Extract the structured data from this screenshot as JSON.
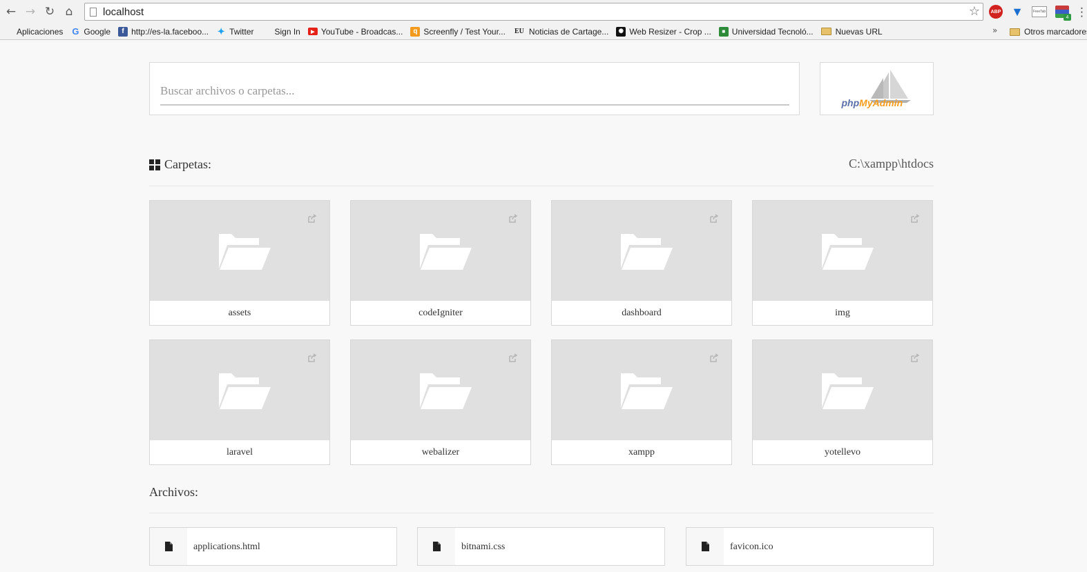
{
  "browser": {
    "url": "localhost",
    "extensions": {
      "abp_label": "ABP",
      "box_label": "FreeTab",
      "badge_count": "4"
    },
    "bookmarks": [
      {
        "label": "Aplicaciones",
        "icon": "apps-grid-icon",
        "color": "#e0453a"
      },
      {
        "label": "Google",
        "icon": "google-icon",
        "color": "#4285f4"
      },
      {
        "label": "http://es-la.faceboo...",
        "icon": "facebook-icon",
        "color": "#3b5998"
      },
      {
        "label": "Twitter",
        "icon": "twitter-icon",
        "color": "#1da1f2"
      },
      {
        "label": "Sign In",
        "icon": "microsoft-icon",
        "color": "#f25022"
      },
      {
        "label": "YouTube - Broadcas...",
        "icon": "youtube-icon",
        "color": "#e62117"
      },
      {
        "label": "Screenfly / Test Your...",
        "icon": "screenfly-icon",
        "color": "#f39a1c"
      },
      {
        "label": "Noticias de Cartage...",
        "icon": "eu-news-icon",
        "color": "#222222"
      },
      {
        "label": "Web Resizer - Crop ...",
        "icon": "web-resizer-icon",
        "color": "#111111"
      },
      {
        "label": "Universidad Tecnoló...",
        "icon": "university-icon",
        "color": "#2e8b3a"
      },
      {
        "label": "Nuevas URL",
        "icon": "folder-icon",
        "color": "#e8c26a"
      }
    ],
    "other_bookmarks": "Otros marcadores"
  },
  "search": {
    "placeholder": "Buscar archivos o carpetas..."
  },
  "phpmyadmin": {
    "php": "php",
    "admin": "MyAdmin"
  },
  "folders_section": {
    "title": "Carpetas:",
    "path": "C:\\xampp\\htdocs",
    "items": [
      "assets",
      "codeIgniter",
      "dashboard",
      "img",
      "laravel",
      "webalizer",
      "xampp",
      "yotellevo"
    ]
  },
  "files_section": {
    "title": "Archivos:",
    "items": [
      "applications.html",
      "bitnami.css",
      "favicon.ico"
    ]
  },
  "colors": {
    "card_top": "#e0e0e0",
    "background": "#f8f8f8",
    "accent_orange": "#f89c1c"
  }
}
